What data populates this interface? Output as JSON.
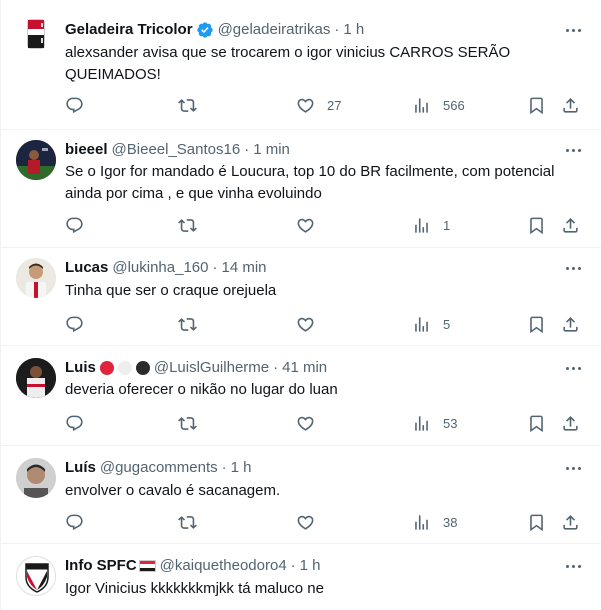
{
  "tweets": [
    {
      "name": "Geladeira Tricolor",
      "handle": "@geladeiratrikas",
      "dot": "·",
      "time": "1 h",
      "text": "alexsander avisa que se trocarem o igor vinicius CARROS SERÃO QUEIMADOS!",
      "likes": "27",
      "views": "566",
      "replies": "",
      "retweets": ""
    },
    {
      "name": "bieeel",
      "handle": "@Bieeel_Santos16",
      "dot": "·",
      "time": "1 min",
      "text": "Se o Igor for mandado é Loucura, top 10 do BR facilmente, com potencial ainda por cima , e que vinha evoluindo",
      "likes": "",
      "views": "1"
    },
    {
      "name": "Lucas",
      "handle": "@lukinha_160",
      "dot": "·",
      "time": "14 min",
      "text": "Tinha que ser o craque orejuela",
      "likes": "",
      "views": "5"
    },
    {
      "name": "Luis",
      "handle": "@LuislGuilherme",
      "dot": "·",
      "time": "41 min",
      "text": "deveria oferecer o nikão no lugar do luan",
      "likes": "",
      "views": "53",
      "badge_colors": [
        "#e0243b",
        "#f0f0f0",
        "#2b2b2b"
      ]
    },
    {
      "name": "Luís",
      "handle": "@gugacomments",
      "dot": "·",
      "time": "1 h",
      "text": "envolver o cavalo é sacanagem.",
      "likes": "",
      "views": "38"
    },
    {
      "name": "Info SPFC",
      "handle": "@kaiquetheodoro4",
      "dot": "·",
      "time": "1 h",
      "text": "Igor Vinicius kkkkkkkmjkk tá maluco ne",
      "flag_colors": [
        "#e0243b",
        "#ffffff",
        "#1a1a1a"
      ]
    }
  ],
  "colors": {
    "text": "#0f1419",
    "secondary": "#536471",
    "verified": "#1d9bf0",
    "divider": "#eff3f4"
  },
  "icons": [
    "reply-icon",
    "retweet-icon",
    "like-icon",
    "views-icon",
    "bookmark-icon",
    "share-icon",
    "more-icon",
    "verified-icon"
  ]
}
